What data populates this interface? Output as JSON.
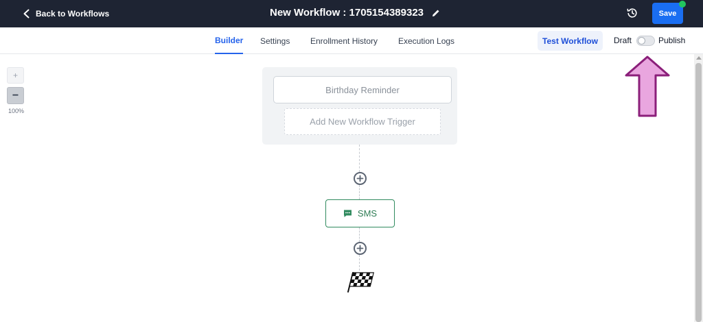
{
  "header": {
    "back_label": "Back to Workflows",
    "title": "New Workflow : 1705154389323",
    "save_label": "Save",
    "status_dot_color": "#22c55e"
  },
  "tabs": [
    {
      "label": "Builder",
      "active": true
    },
    {
      "label": "Settings",
      "active": false
    },
    {
      "label": "Enrollment History",
      "active": false
    },
    {
      "label": "Execution Logs",
      "active": false
    }
  ],
  "actions": {
    "test_label": "Test Workflow",
    "draft_label": "Draft",
    "publish_label": "Publish",
    "publish_toggle_on": false
  },
  "zoom": {
    "plus": "+",
    "minus": "−",
    "level": "100%"
  },
  "canvas": {
    "trigger_label": "Birthday Reminder",
    "add_trigger_label": "Add New Workflow Trigger",
    "action_label": "SMS",
    "end_icon": "checkered-flag-icon"
  },
  "colors": {
    "topbar": "#1e2433",
    "accent": "#2563eb",
    "save": "#1a6ef2",
    "sms": "#2f8a5e",
    "annotation": "#e9a6df"
  }
}
